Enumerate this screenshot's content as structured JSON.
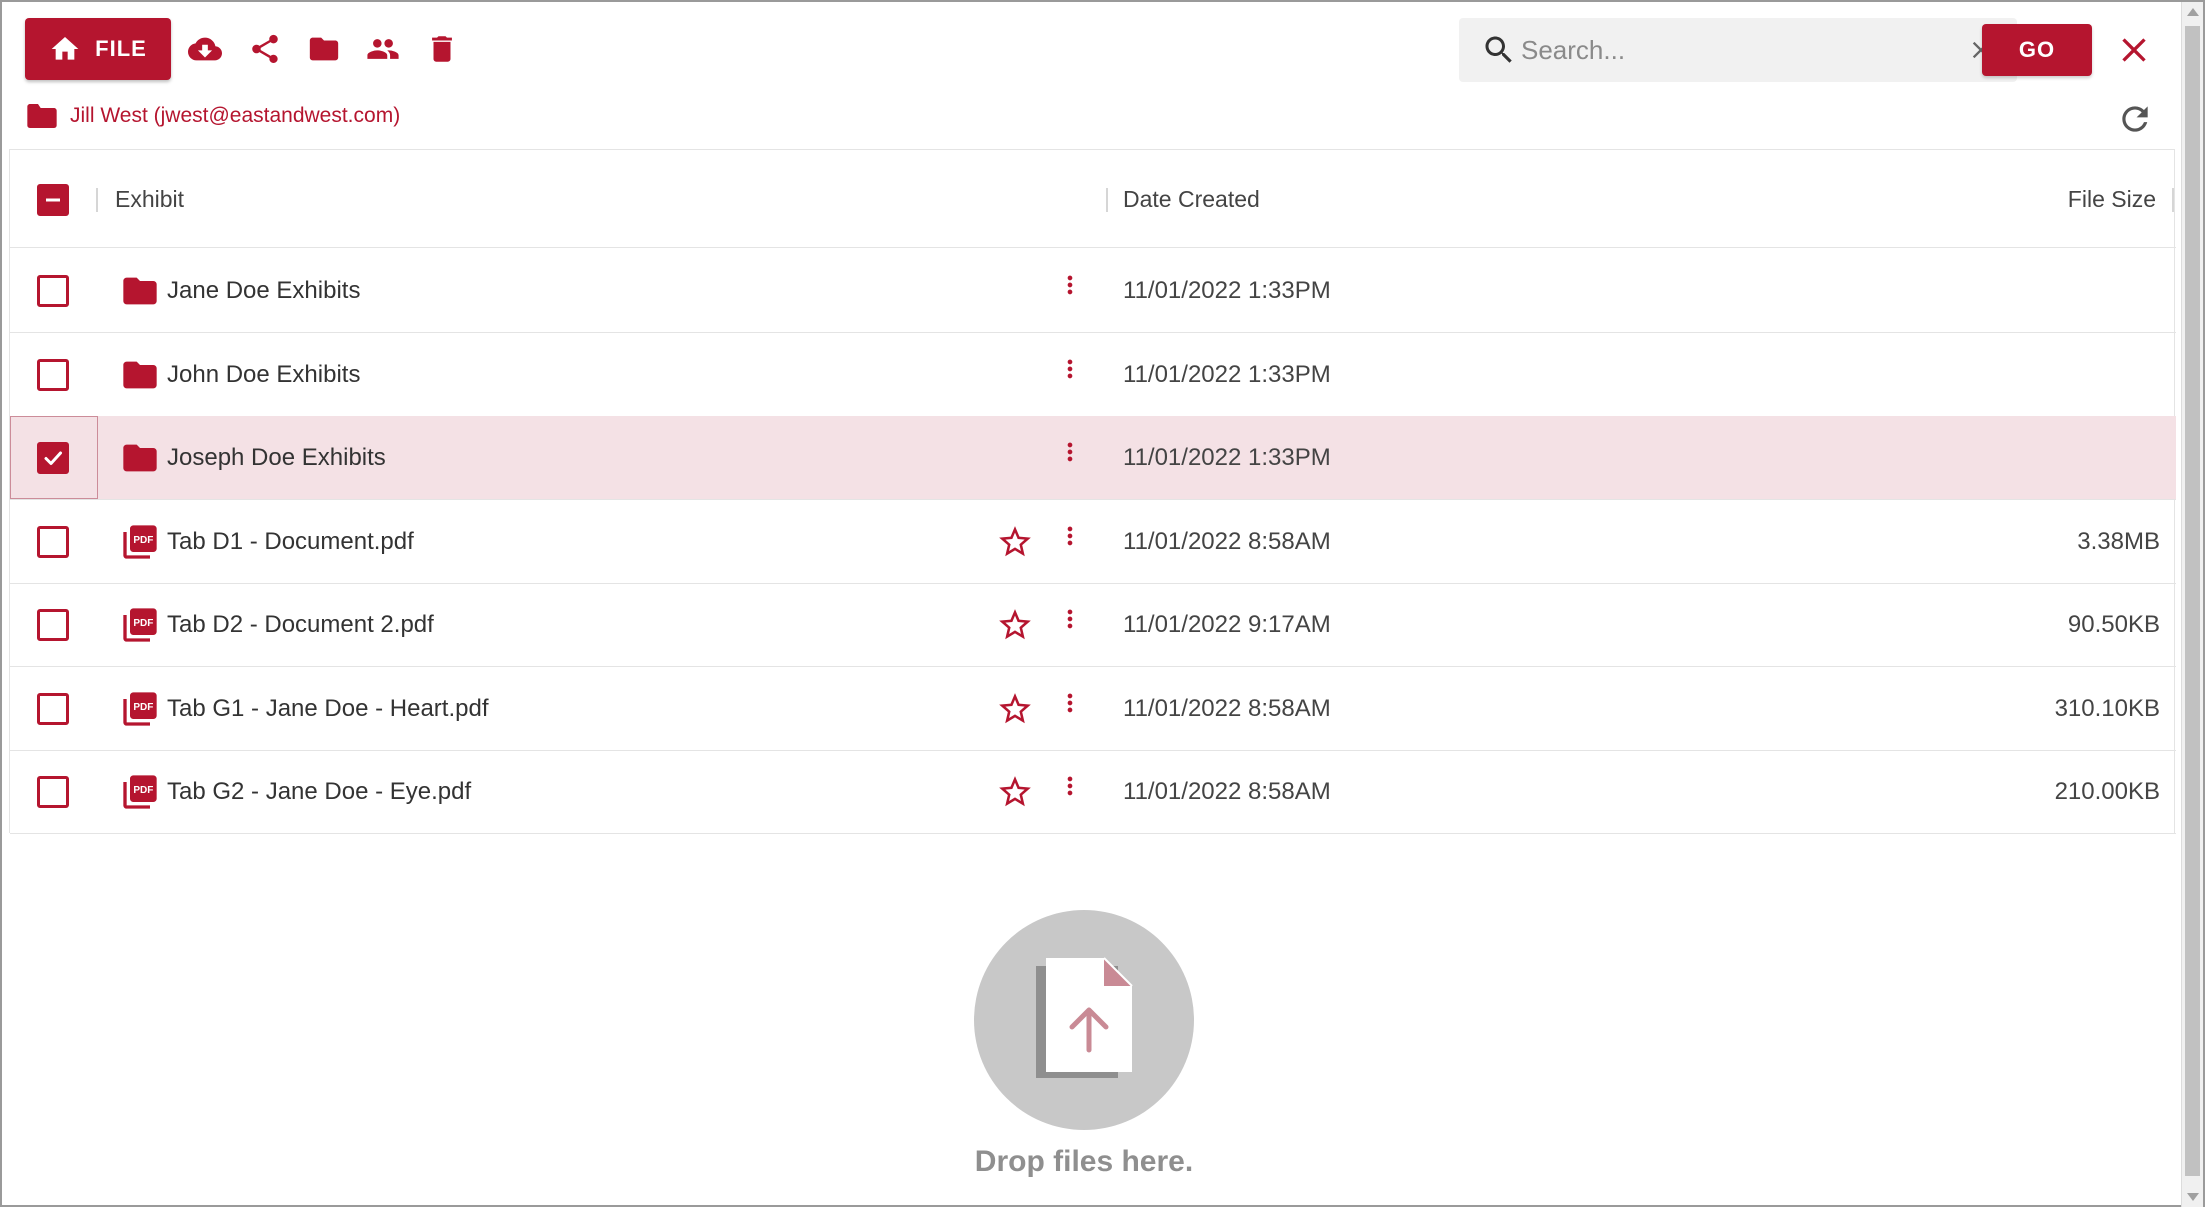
{
  "toolbar": {
    "file_label": "FILE",
    "icons": [
      "cloud-download-icon",
      "share-icon",
      "folder-icon",
      "people-icon",
      "trash-icon"
    ]
  },
  "search": {
    "placeholder": "Search...",
    "value": "",
    "go_label": "GO"
  },
  "breadcrumb": {
    "label": "Jill West (jwest@eastandwest.com)"
  },
  "table": {
    "columns": {
      "exhibit": "Exhibit",
      "date_created": "Date Created",
      "file_size": "File Size"
    },
    "header_checkbox_state": "indeterminate",
    "rows": [
      {
        "type": "folder",
        "name": "Jane Doe Exhibits",
        "date": "11/01/2022 1:33PM",
        "size": "",
        "checked": false
      },
      {
        "type": "folder",
        "name": "John Doe Exhibits",
        "date": "11/01/2022 1:33PM",
        "size": "",
        "checked": false
      },
      {
        "type": "folder",
        "name": "Joseph Doe Exhibits",
        "date": "11/01/2022 1:33PM",
        "size": "",
        "checked": true
      },
      {
        "type": "pdf",
        "name": "Tab D1 - Document.pdf",
        "date": "11/01/2022 8:58AM",
        "size": "3.38MB",
        "checked": false
      },
      {
        "type": "pdf",
        "name": "Tab D2 - Document 2.pdf",
        "date": "11/01/2022 9:17AM",
        "size": "90.50KB",
        "checked": false
      },
      {
        "type": "pdf",
        "name": "Tab G1 - Jane Doe - Heart.pdf",
        "date": "11/01/2022 8:58AM",
        "size": "310.10KB",
        "checked": false
      },
      {
        "type": "pdf",
        "name": "Tab G2 - Jane Doe - Eye.pdf",
        "date": "11/01/2022 8:58AM",
        "size": "210.00KB",
        "checked": false
      }
    ]
  },
  "dropzone": {
    "text": "Drop files here."
  },
  "colors": {
    "accent": "#b5152f",
    "selected_row": "#f4e1e5",
    "search_bg": "#f1f1f1"
  }
}
